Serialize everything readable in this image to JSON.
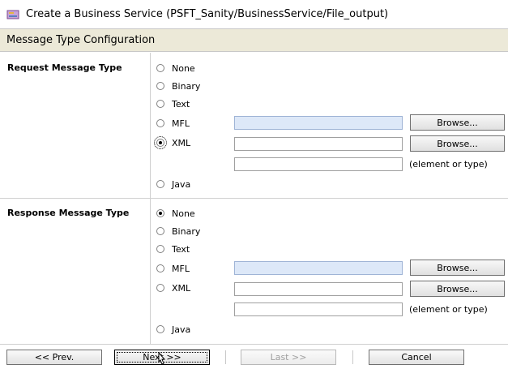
{
  "window": {
    "title": "Create a Business Service (PSFT_Sanity/BusinessService/File_output)"
  },
  "section": {
    "title": "Message Type Configuration"
  },
  "request": {
    "label": "Request Message Type",
    "options": {
      "none": "None",
      "binary": "Binary",
      "text": "Text",
      "mfl": "MFL",
      "xml": "XML",
      "java": "Java"
    },
    "selected": "XML",
    "browse_label": "Browse...",
    "element_hint": "(element or type)"
  },
  "response": {
    "label": "Response Message Type",
    "options": {
      "none": "None",
      "binary": "Binary",
      "text": "Text",
      "mfl": "MFL",
      "xml": "XML",
      "java": "Java"
    },
    "selected": "None",
    "browse_label": "Browse...",
    "element_hint": "(element or type)"
  },
  "footer": {
    "prev": "<< Prev.",
    "next": "Next >>",
    "last": "Last >>",
    "cancel": "Cancel"
  },
  "colors": {
    "section_bg": "#ece9d8",
    "mfl_field_bg": "#dde8f8"
  }
}
